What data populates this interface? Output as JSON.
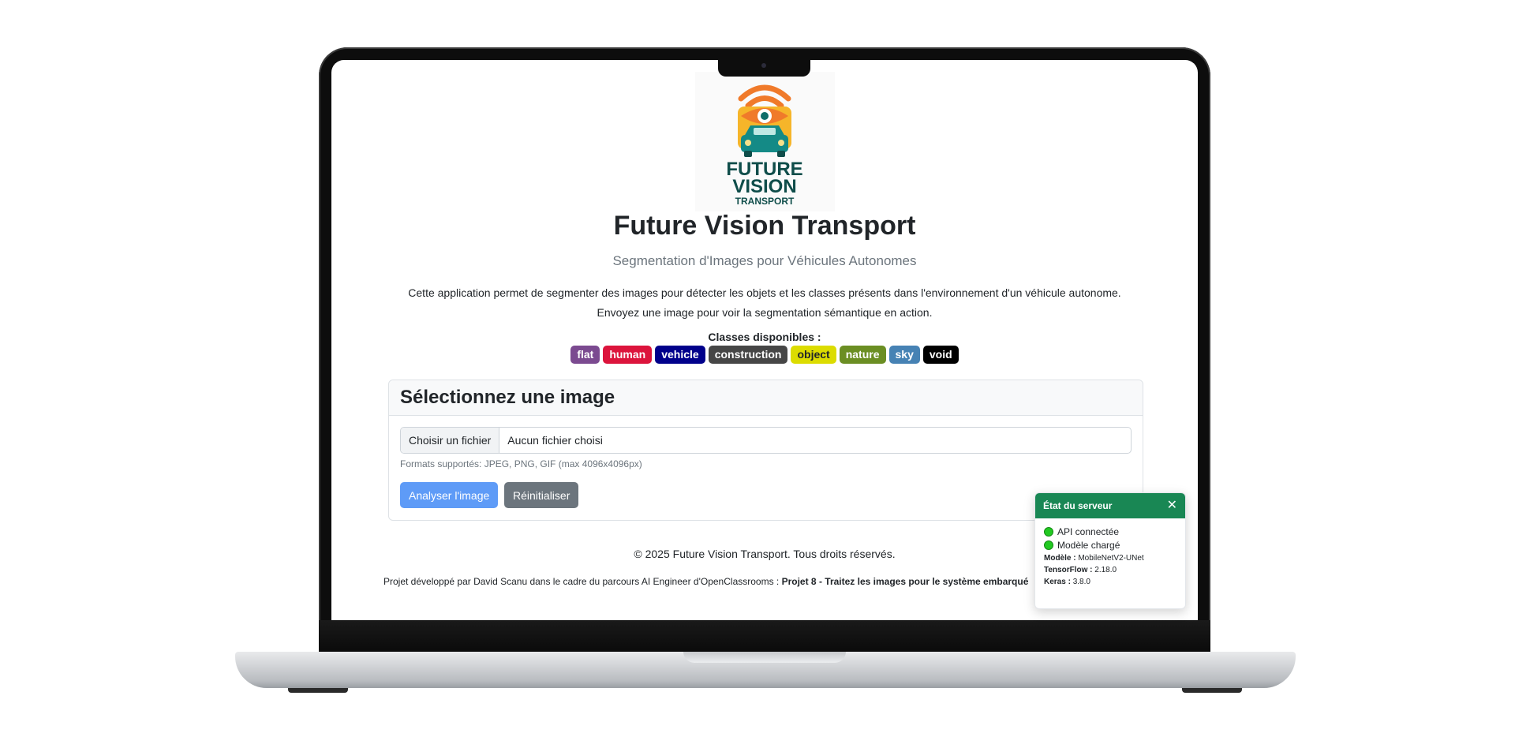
{
  "header": {
    "logo_text": [
      "FUTURE",
      "VISION",
      "TRANSPORT"
    ],
    "title": "Future Vision Transport",
    "subtitle": "Segmentation d'Images pour Véhicules Autonomes",
    "description_1": "Cette application permet de segmenter des images pour détecter les objets et les classes présents dans l'environnement d'un véhicule autonome.",
    "description_2": "Envoyez une image pour voir la segmentation sémantique en action."
  },
  "classes": {
    "label": "Classes disponibles :",
    "items": [
      {
        "label": "flat",
        "color": "#7b4a90"
      },
      {
        "label": "human",
        "color": "#dc143c"
      },
      {
        "label": "vehicle",
        "color": "#00008b"
      },
      {
        "label": "construction",
        "color": "#464646"
      },
      {
        "label": "object",
        "color": "#dcdc00"
      },
      {
        "label": "nature",
        "color": "#6b8e23"
      },
      {
        "label": "sky",
        "color": "#4682b4"
      },
      {
        "label": "void",
        "color": "#000000"
      }
    ]
  },
  "upload": {
    "title": "Sélectionnez une image",
    "file_button": "Choisir un fichier",
    "file_name": "Aucun fichier choisi",
    "help": "Formats supportés: JPEG, PNG, GIF (max 4096x4096px)",
    "analyze": "Analyser l'image",
    "reset": "Réinitialiser"
  },
  "footer": {
    "copyright": "© 2025 Future Vision Transport. Tous droits réservés.",
    "credit_prefix": "Projet développé par David Scanu dans le cadre du parcours AI Engineer d'OpenClassrooms :",
    "credit_bold": "Projet 8 - Traitez les images pour le système embarqué"
  },
  "server": {
    "title": "État du serveur",
    "api": "API connectée",
    "model_loaded": "Modèle chargé",
    "model_label": "Modèle :",
    "model_value": "MobileNetV2-UNet",
    "tf_label": "TensorFlow :",
    "tf_value": "2.18.0",
    "keras_label": "Keras :",
    "keras_value": "3.8.0",
    "status_color": "#22c922",
    "header_color": "#198754"
  }
}
